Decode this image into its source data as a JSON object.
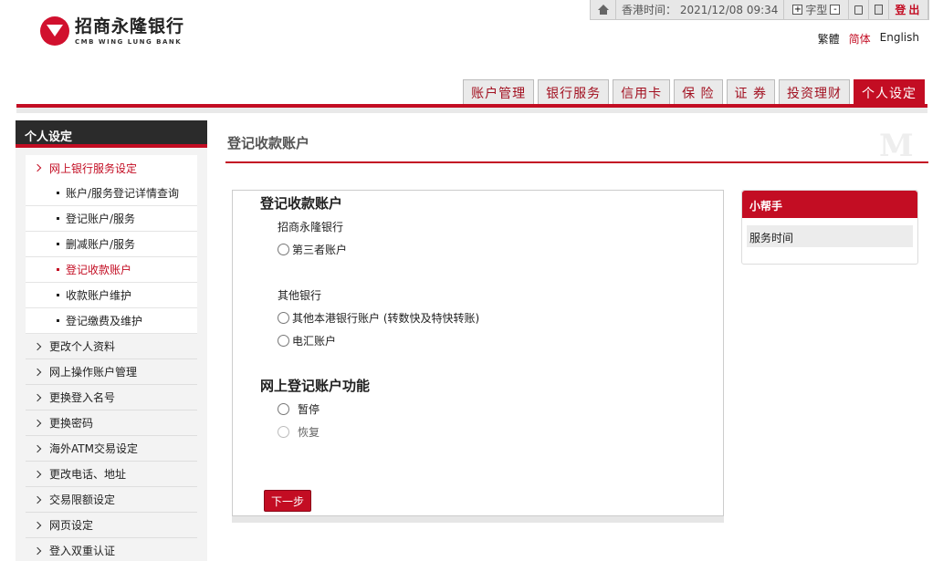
{
  "logo": {
    "cn": "招商永隆银行",
    "en": "CMB WING LUNG BANK"
  },
  "topbar": {
    "time_label": "香港时间：",
    "time_value": "2021/12/08 09:34",
    "font_label": "字型",
    "plus": "+",
    "minus": "-",
    "logout": "登出"
  },
  "lang": {
    "trad": "繁體",
    "simp": "简体",
    "en": "English"
  },
  "tabs": [
    "账户管理",
    "银行服务",
    "信用卡",
    "保 险",
    "证 券",
    "投资理财",
    "个人设定"
  ],
  "sidebar": {
    "title": "个人设定",
    "open_item": "网上银行服务设定",
    "sub_items": [
      "账户/服务登记详情查询",
      "登记账户/服务",
      "删减账户/服务",
      "登记收款账户",
      "收款账户维护",
      "登记缴费及维护"
    ],
    "items": [
      "更改个人资料",
      "网上操作账户管理",
      "更换登入名号",
      "更换密码",
      "海外ATM交易设定",
      "更改电话、地址",
      "交易限额设定",
      "网页设定",
      "登入双重认证"
    ]
  },
  "content": {
    "page_title": "登记收款账户",
    "form_title": "登记收款账户",
    "group1_label": "招商永隆银行",
    "opt_third_party": "第三者账户",
    "group2_label": "其他银行",
    "opt_local_bank": "其他本港银行账户 (转数快及特快转账)",
    "opt_wire": "电汇账户",
    "section2_title": "网上登记账户功能",
    "opt_suspend": "暂停",
    "opt_resume": "恢复",
    "next_button": "下一步"
  },
  "helper": {
    "title": "小帮手",
    "item": "服务时间"
  },
  "colors": {
    "brand_red": "#c30d23",
    "sidebar_header": "#2b2b2b"
  }
}
